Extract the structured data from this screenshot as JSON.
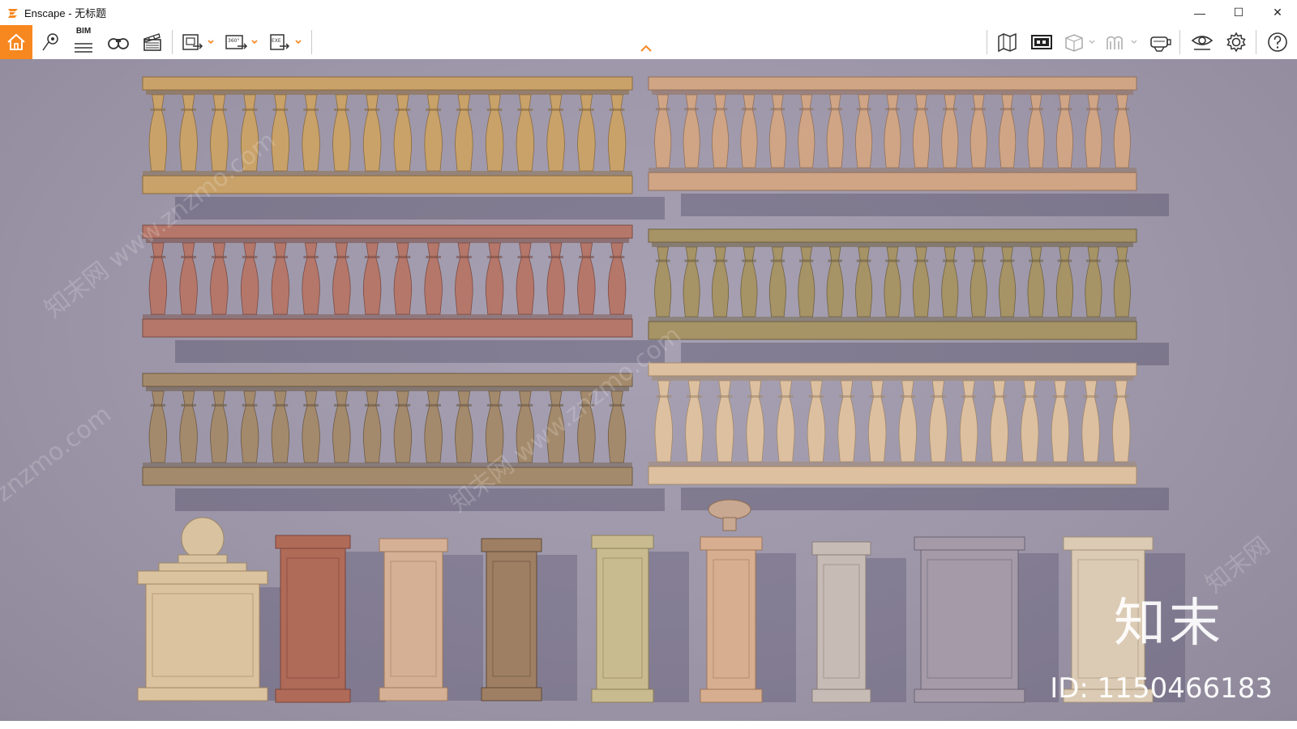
{
  "window": {
    "title": "Enscape - 无标题",
    "controls": {
      "minimize": "—",
      "maximize": "☐",
      "close": "✕"
    }
  },
  "toolbar": {
    "bim_label": "BIM",
    "left_buttons": [
      "home-icon",
      "location-pin-icon",
      "bim-icon",
      "binoculars-icon",
      "clapper-icon"
    ],
    "export_buttons": [
      "screenshot-export-icon",
      "panorama-360-export-icon",
      "exe-export-icon"
    ],
    "export_badges": [
      "",
      "360°",
      "EXE"
    ],
    "right_buttons": [
      "map-icon",
      "video-editor-icon",
      "cube-icon",
      "asset-library-icon",
      "vr-headset-icon",
      "visual-settings-icon",
      "settings-gear-icon",
      "help-icon"
    ],
    "accent_color": "#f7871f"
  },
  "viewport": {
    "scene": "balustrade and stone pillar models render",
    "watermark_brand": "知末",
    "watermark_id": "ID: 1150466183",
    "watermark_diagonal": [
      "知末网 www.znzmo.com",
      "znzmo.com",
      "知末网 www.znzmo.com",
      "知末网"
    ]
  }
}
